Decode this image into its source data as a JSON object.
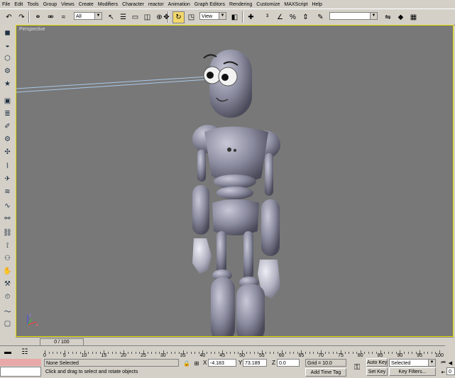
{
  "menu": [
    "File",
    "Edit",
    "Tools",
    "Group",
    "Views",
    "Create",
    "Modifiers",
    "Character",
    "reactor",
    "Animation",
    "Graph Editors",
    "Rendering",
    "Customize",
    "MAXScript",
    "Help"
  ],
  "toolbar": {
    "selection_filter": "All",
    "reference_coord": "View",
    "named_selection": ""
  },
  "viewport": {
    "label": "Perspective"
  },
  "timeline": {
    "frame_display": "0 / 100",
    "ticks": [
      "0",
      "5",
      "10",
      "15",
      "20",
      "25",
      "30",
      "35",
      "40",
      "45",
      "50",
      "55",
      "60",
      "65",
      "70",
      "75",
      "80",
      "85",
      "90",
      "95",
      "100"
    ]
  },
  "status": {
    "selection_text": "None Selected",
    "prompt_text": "Click and drag to select and rotate objects",
    "x_label": "X",
    "x_value": "-4.183",
    "y_label": "Y",
    "y_value": "73.189",
    "z_label": "Z",
    "z_value": "0.0",
    "grid": "Grid = 10.0",
    "add_time_tag": "Add Time Tag",
    "auto_key": "Auto Key",
    "set_key": "Set Key",
    "key_mode": "Selected",
    "key_filters": "Key Filters...",
    "frame_field": "0"
  },
  "colors": {
    "viewport_bg": "#787878",
    "active_border": "#e8e000",
    "character": "#8a8a9c"
  }
}
